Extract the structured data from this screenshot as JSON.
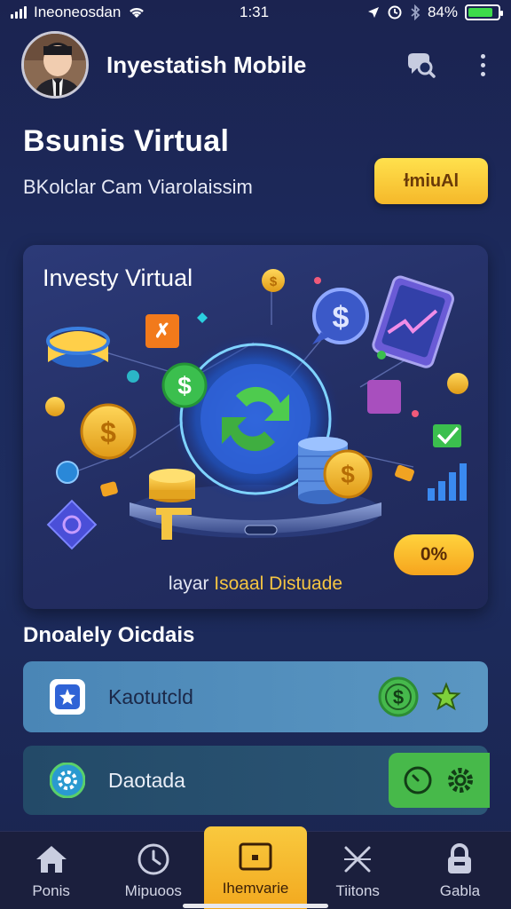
{
  "status_bar": {
    "carrier": "Ineoneosdan",
    "time": "1:31",
    "battery_percent": "84%",
    "battery_level": 0.84
  },
  "header": {
    "app_title": "Inyestatish Mobile"
  },
  "hero": {
    "title": "Bsunis Virtual",
    "subtitle": "BKolclar Cam Viarolaissim",
    "button_label": "ɫmiuAl"
  },
  "feature": {
    "title": "Investy Virtual",
    "caption_prefix": "layar",
    "caption_accent": "Isoaal Distuade",
    "pill_label": "0%"
  },
  "section": {
    "title": "Dnoalely Oicdais"
  },
  "list": [
    {
      "label": "Kaotutcld"
    },
    {
      "label": "Daotada"
    }
  ],
  "tabbar": [
    {
      "label": "Ponis",
      "icon": "home-icon"
    },
    {
      "label": "Mipuoos",
      "icon": "clock-icon"
    },
    {
      "label": "Ihemvarie",
      "icon": "wallet-icon"
    },
    {
      "label": "Tiitons",
      "icon": "cross-icon"
    },
    {
      "label": "Gabla",
      "icon": "lock-icon"
    }
  ],
  "colors": {
    "background": "#1c2a5c",
    "accent_yellow": "#f5c542",
    "green": "#47b94a",
    "card_blue": "#4a86b6"
  }
}
